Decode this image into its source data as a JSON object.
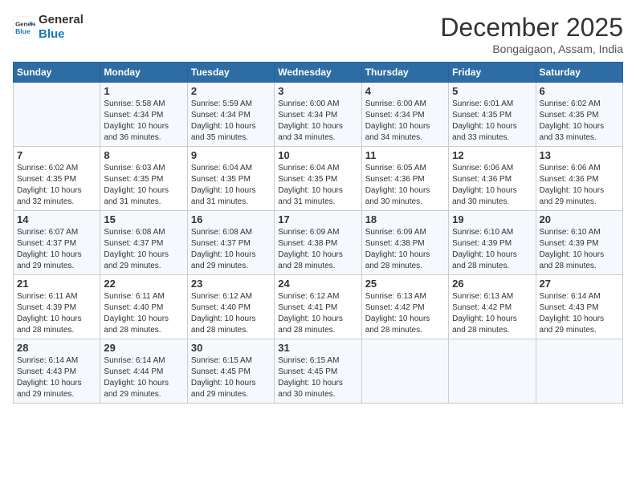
{
  "header": {
    "logo_line1": "General",
    "logo_line2": "Blue",
    "month": "December 2025",
    "location": "Bongaigaon, Assam, India"
  },
  "days_of_week": [
    "Sunday",
    "Monday",
    "Tuesday",
    "Wednesday",
    "Thursday",
    "Friday",
    "Saturday"
  ],
  "weeks": [
    [
      {
        "day": "",
        "info": ""
      },
      {
        "day": "1",
        "info": "Sunrise: 5:58 AM\nSunset: 4:34 PM\nDaylight: 10 hours\nand 36 minutes."
      },
      {
        "day": "2",
        "info": "Sunrise: 5:59 AM\nSunset: 4:34 PM\nDaylight: 10 hours\nand 35 minutes."
      },
      {
        "day": "3",
        "info": "Sunrise: 6:00 AM\nSunset: 4:34 PM\nDaylight: 10 hours\nand 34 minutes."
      },
      {
        "day": "4",
        "info": "Sunrise: 6:00 AM\nSunset: 4:34 PM\nDaylight: 10 hours\nand 34 minutes."
      },
      {
        "day": "5",
        "info": "Sunrise: 6:01 AM\nSunset: 4:35 PM\nDaylight: 10 hours\nand 33 minutes."
      },
      {
        "day": "6",
        "info": "Sunrise: 6:02 AM\nSunset: 4:35 PM\nDaylight: 10 hours\nand 33 minutes."
      }
    ],
    [
      {
        "day": "7",
        "info": "Sunrise: 6:02 AM\nSunset: 4:35 PM\nDaylight: 10 hours\nand 32 minutes."
      },
      {
        "day": "8",
        "info": "Sunrise: 6:03 AM\nSunset: 4:35 PM\nDaylight: 10 hours\nand 31 minutes."
      },
      {
        "day": "9",
        "info": "Sunrise: 6:04 AM\nSunset: 4:35 PM\nDaylight: 10 hours\nand 31 minutes."
      },
      {
        "day": "10",
        "info": "Sunrise: 6:04 AM\nSunset: 4:35 PM\nDaylight: 10 hours\nand 31 minutes."
      },
      {
        "day": "11",
        "info": "Sunrise: 6:05 AM\nSunset: 4:36 PM\nDaylight: 10 hours\nand 30 minutes."
      },
      {
        "day": "12",
        "info": "Sunrise: 6:06 AM\nSunset: 4:36 PM\nDaylight: 10 hours\nand 30 minutes."
      },
      {
        "day": "13",
        "info": "Sunrise: 6:06 AM\nSunset: 4:36 PM\nDaylight: 10 hours\nand 29 minutes."
      }
    ],
    [
      {
        "day": "14",
        "info": "Sunrise: 6:07 AM\nSunset: 4:37 PM\nDaylight: 10 hours\nand 29 minutes."
      },
      {
        "day": "15",
        "info": "Sunrise: 6:08 AM\nSunset: 4:37 PM\nDaylight: 10 hours\nand 29 minutes."
      },
      {
        "day": "16",
        "info": "Sunrise: 6:08 AM\nSunset: 4:37 PM\nDaylight: 10 hours\nand 29 minutes."
      },
      {
        "day": "17",
        "info": "Sunrise: 6:09 AM\nSunset: 4:38 PM\nDaylight: 10 hours\nand 28 minutes."
      },
      {
        "day": "18",
        "info": "Sunrise: 6:09 AM\nSunset: 4:38 PM\nDaylight: 10 hours\nand 28 minutes."
      },
      {
        "day": "19",
        "info": "Sunrise: 6:10 AM\nSunset: 4:39 PM\nDaylight: 10 hours\nand 28 minutes."
      },
      {
        "day": "20",
        "info": "Sunrise: 6:10 AM\nSunset: 4:39 PM\nDaylight: 10 hours\nand 28 minutes."
      }
    ],
    [
      {
        "day": "21",
        "info": "Sunrise: 6:11 AM\nSunset: 4:39 PM\nDaylight: 10 hours\nand 28 minutes."
      },
      {
        "day": "22",
        "info": "Sunrise: 6:11 AM\nSunset: 4:40 PM\nDaylight: 10 hours\nand 28 minutes."
      },
      {
        "day": "23",
        "info": "Sunrise: 6:12 AM\nSunset: 4:40 PM\nDaylight: 10 hours\nand 28 minutes."
      },
      {
        "day": "24",
        "info": "Sunrise: 6:12 AM\nSunset: 4:41 PM\nDaylight: 10 hours\nand 28 minutes."
      },
      {
        "day": "25",
        "info": "Sunrise: 6:13 AM\nSunset: 4:42 PM\nDaylight: 10 hours\nand 28 minutes."
      },
      {
        "day": "26",
        "info": "Sunrise: 6:13 AM\nSunset: 4:42 PM\nDaylight: 10 hours\nand 28 minutes."
      },
      {
        "day": "27",
        "info": "Sunrise: 6:14 AM\nSunset: 4:43 PM\nDaylight: 10 hours\nand 29 minutes."
      }
    ],
    [
      {
        "day": "28",
        "info": "Sunrise: 6:14 AM\nSunset: 4:43 PM\nDaylight: 10 hours\nand 29 minutes."
      },
      {
        "day": "29",
        "info": "Sunrise: 6:14 AM\nSunset: 4:44 PM\nDaylight: 10 hours\nand 29 minutes."
      },
      {
        "day": "30",
        "info": "Sunrise: 6:15 AM\nSunset: 4:45 PM\nDaylight: 10 hours\nand 29 minutes."
      },
      {
        "day": "31",
        "info": "Sunrise: 6:15 AM\nSunset: 4:45 PM\nDaylight: 10 hours\nand 30 minutes."
      },
      {
        "day": "",
        "info": ""
      },
      {
        "day": "",
        "info": ""
      },
      {
        "day": "",
        "info": ""
      }
    ]
  ]
}
